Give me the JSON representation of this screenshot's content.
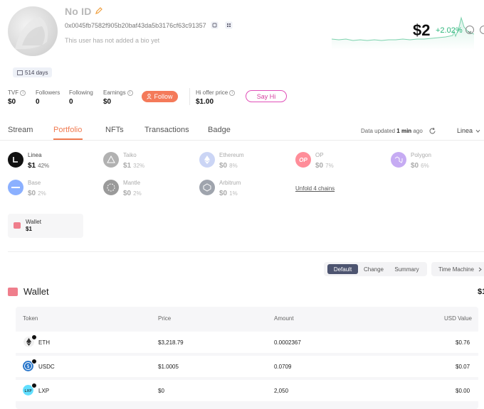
{
  "profile": {
    "name": "No ID",
    "address": "0x0045fb7582f905b20baf43da5b3176cf63c91357",
    "bio": "This user has not added a bio yet",
    "days_badge": "514 days"
  },
  "stats": {
    "tvf_label": "TVF",
    "tvf_value": "$0",
    "followers_label": "Followers",
    "followers_value": "0",
    "following_label": "Following",
    "following_value": "0",
    "earnings_label": "Earnings",
    "earnings_value": "$0",
    "follow_button": "Follow",
    "hi_offer_label": "Hi offer price",
    "hi_offer_value": "$1.00",
    "say_hi_button": "Say Hi"
  },
  "balance": {
    "value": "$2",
    "change": "+2.02%",
    "change_color": "#29b579"
  },
  "tabs": {
    "stream": "Stream",
    "portfolio": "Portfolio",
    "nfts": "NFTs",
    "transactions": "Transactions",
    "badge": "Badge",
    "active": "Portfolio",
    "accent": "#f07a50"
  },
  "data_updated": {
    "prefix": "Data updated",
    "time": "1 min",
    "suffix": "ago"
  },
  "chain_selector": "Linea",
  "chains": [
    {
      "name": "Linea",
      "value": "$1",
      "pct": "42%",
      "icon": "linea-icon",
      "color": "#111111"
    },
    {
      "name": "Taiko",
      "value": "$1",
      "pct": "32%",
      "icon": "taiko-icon",
      "color": "#c8477f"
    },
    {
      "name": "Ethereum",
      "value": "$0",
      "pct": "8%",
      "icon": "ethereum-icon",
      "color": "#8ea4ea"
    },
    {
      "name": "OP",
      "value": "$0",
      "pct": "7%",
      "icon": "op-icon",
      "color": "#ff0420"
    },
    {
      "name": "Polygon",
      "value": "$0",
      "pct": "6%",
      "icon": "polygon-icon",
      "color": "#8247e5"
    },
    {
      "name": "Base",
      "value": "$0",
      "pct": "2%",
      "icon": "base-icon",
      "color": "#0052ff"
    },
    {
      "name": "Mantle",
      "value": "$0",
      "pct": "2%",
      "icon": "mantle-icon",
      "color": "#222222"
    },
    {
      "name": "Arbitrum",
      "value": "$0",
      "pct": "1%",
      "icon": "arbitrum-icon",
      "color": "#2d374b"
    }
  ],
  "unfold_link": "Unfold 4 chains",
  "wallet_card": {
    "label": "Wallet",
    "value": "$1"
  },
  "view_modes": {
    "default": "Default",
    "change": "Change",
    "summary": "Summary",
    "time_machine": "Time Machine",
    "active": "Default"
  },
  "wallet_section": {
    "title": "Wallet",
    "total": "$1",
    "columns": {
      "token": "Token",
      "price": "Price",
      "amount": "Amount",
      "usd_value": "USD Value"
    },
    "rows": [
      {
        "token": "ETH",
        "price": "$3,218.79",
        "amount": "0.0002367",
        "usd_value": "$0.76",
        "icon": "eth-token-icon"
      },
      {
        "token": "USDC",
        "price": "$1.0005",
        "amount": "0.0709",
        "usd_value": "$0.07",
        "icon": "usdc-token-icon"
      },
      {
        "token": "LXP",
        "price": "$0",
        "amount": "2,050",
        "usd_value": "$0.00",
        "icon": "lxp-token-icon",
        "icon_text": "LXP"
      }
    ]
  }
}
